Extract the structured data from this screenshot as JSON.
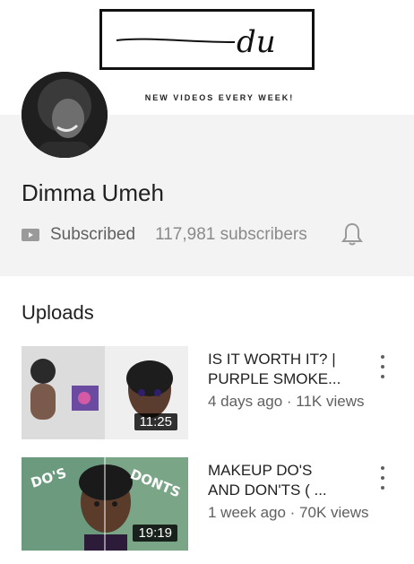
{
  "banner": {
    "logo_text": "du",
    "tagline": "NEW VIDEOS EVERY WEEK!"
  },
  "channel": {
    "name": "Dimma Umeh",
    "subscribed_label": "Subscribed",
    "subscribers": "117,981 subscribers"
  },
  "uploads": {
    "title": "Uploads",
    "videos": [
      {
        "title_line1": "IS IT WORTH IT? |",
        "title_line2": "PURPLE SMOKE...",
        "meta": "4 days ago · 11K views",
        "duration": "11:25"
      },
      {
        "title_line1": "MAKEUP DO'S",
        "title_line2": "AND DON'TS  ( ...",
        "meta": "1 week ago · 70K views",
        "duration": "19:19",
        "overlay_left": "DO'S",
        "overlay_right": "DONTS"
      }
    ]
  },
  "icons": {
    "subscribed": "youtube-subscribed-icon",
    "notifications": "bell-icon",
    "more": "more-vert-icon"
  }
}
